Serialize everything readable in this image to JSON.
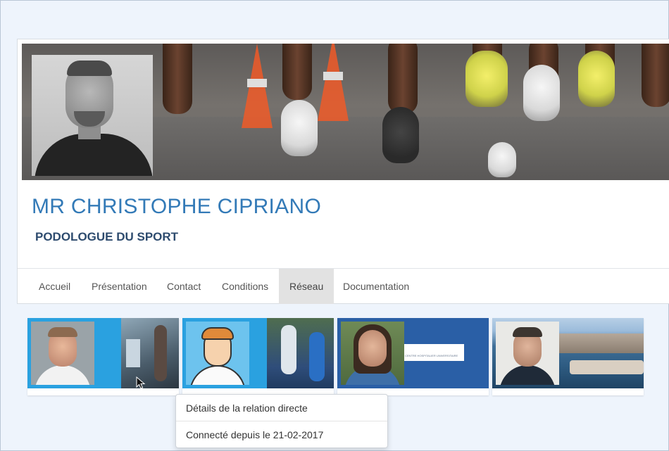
{
  "profile": {
    "name": "MR CHRISTOPHE CIPRIANO",
    "title": "PODOLOGUE DU SPORT"
  },
  "tabs": [
    {
      "label": "Accueil",
      "active": false
    },
    {
      "label": "Présentation",
      "active": false
    },
    {
      "label": "Contact",
      "active": false
    },
    {
      "label": "Conditions",
      "active": false
    },
    {
      "label": "Réseau",
      "active": true
    },
    {
      "label": "Documentation",
      "active": false
    }
  ],
  "network": {
    "card_3_cover_text": "CENTRE HOSPITALIER UNIVERSITAIRE"
  },
  "tooltip": {
    "heading": "Détails de la relation directe",
    "detail": "Connecté depuis le 21-02-2017"
  },
  "colors": {
    "name_blue": "#337ab7",
    "card_blue": "#2aa1e0",
    "card_dark_blue": "#2a5fa6",
    "active_tab_bg": "#e2e2e2",
    "page_bg": "#eef4fc"
  },
  "icons": [
    "mouse-pointer-icon"
  ]
}
